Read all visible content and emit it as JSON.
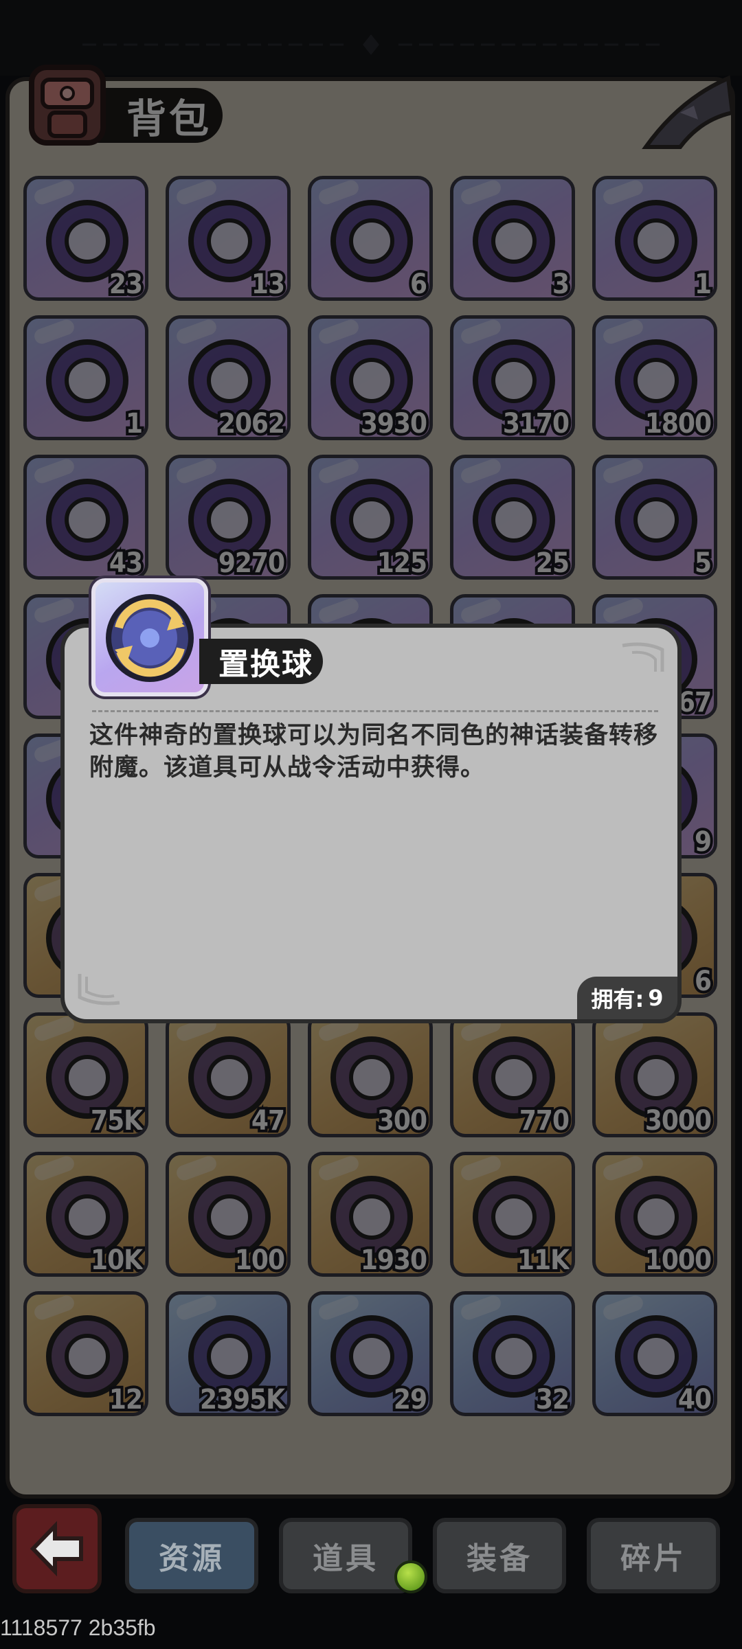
{
  "header": {
    "title": "背包"
  },
  "items": [
    {
      "count": "23",
      "icon": "sword-orb-icon",
      "style": "purple"
    },
    {
      "count": "13",
      "icon": "armor-orb-icon",
      "style": "purple"
    },
    {
      "count": "6",
      "icon": "helmet-orb-icon",
      "style": "purple"
    },
    {
      "count": "3",
      "icon": "ring-orb-icon",
      "style": "purple"
    },
    {
      "count": "1",
      "icon": "emblem-icon",
      "style": "purple"
    },
    {
      "count": "1",
      "icon": "ink-bag-icon",
      "style": "purple"
    },
    {
      "count": "2062",
      "icon": "ruby-gem-icon",
      "style": "purple"
    },
    {
      "count": "3930",
      "icon": "star-badge-icon",
      "style": "purple"
    },
    {
      "count": "3170",
      "icon": "slime-icon",
      "style": "purple"
    },
    {
      "count": "1800",
      "icon": "crown-icon",
      "style": "purple"
    },
    {
      "count": "43",
      "icon": "lotus-icon",
      "style": "purple"
    },
    {
      "count": "9270",
      "icon": "purple-crown-icon",
      "style": "purple"
    },
    {
      "count": "125",
      "icon": "dark-amulet-icon",
      "style": "purple"
    },
    {
      "count": "25",
      "icon": "quill-icon",
      "style": "purple"
    },
    {
      "count": "5",
      "icon": "helmet-book-icon",
      "style": "purple"
    },
    {
      "count": "",
      "icon": "item-icon",
      "style": "purple"
    },
    {
      "count": "",
      "icon": "item-icon",
      "style": "purple"
    },
    {
      "count": "",
      "icon": "item-icon",
      "style": "purple"
    },
    {
      "count": "",
      "icon": "item-icon",
      "style": "purple"
    },
    {
      "count": "67",
      "icon": "item-icon",
      "style": "purple"
    },
    {
      "count": "",
      "icon": "item-icon",
      "style": "purple"
    },
    {
      "count": "",
      "icon": "item-icon",
      "style": "purple"
    },
    {
      "count": "",
      "icon": "item-icon",
      "style": "purple"
    },
    {
      "count": "",
      "icon": "item-icon",
      "style": "purple"
    },
    {
      "count": "9",
      "icon": "item-icon",
      "style": "purple"
    },
    {
      "count": "",
      "icon": "item-icon",
      "style": "gold"
    },
    {
      "count": "",
      "icon": "item-icon",
      "style": "gold"
    },
    {
      "count": "",
      "icon": "item-icon",
      "style": "gold"
    },
    {
      "count": "",
      "icon": "item-icon",
      "style": "gold"
    },
    {
      "count": "6",
      "icon": "item-icon",
      "style": "gold"
    },
    {
      "count": "75K",
      "icon": "crystal-ball-icon",
      "style": "gold"
    },
    {
      "count": "47",
      "icon": "card-icon",
      "style": "gold"
    },
    {
      "count": "300",
      "icon": "banner-icon",
      "style": "gold"
    },
    {
      "count": "770",
      "icon": "shirt-icon",
      "style": "gold"
    },
    {
      "count": "3000",
      "icon": "green-slime-icon",
      "style": "gold"
    },
    {
      "count": "10K",
      "icon": "blue-amulet-icon",
      "style": "gold"
    },
    {
      "count": "100",
      "icon": "feather-orb-icon",
      "style": "gold"
    },
    {
      "count": "1930",
      "icon": "goblet-icon",
      "style": "gold"
    },
    {
      "count": "11K",
      "icon": "heart-icon",
      "style": "gold"
    },
    {
      "count": "1000",
      "icon": "green-rune-icon",
      "style": "gold"
    },
    {
      "count": "12",
      "icon": "dice-icon",
      "style": "gold"
    },
    {
      "count": "2395K",
      "icon": "ice-crystal-icon",
      "style": "blue"
    },
    {
      "count": "29",
      "icon": "sword-orb-icon",
      "style": "blue"
    },
    {
      "count": "32",
      "icon": "armor-orb-icon",
      "style": "blue"
    },
    {
      "count": "40",
      "icon": "helmet-orb-icon",
      "style": "blue"
    }
  ],
  "dialog": {
    "item_name": "置换球",
    "description": "这件神奇的置换球可以为同名不同色的神话装备转移附魔。该道具可从战令活动中获得。",
    "owned_label": "拥有:",
    "owned_count": "9"
  },
  "bottom_tabs": [
    "资源",
    "道具",
    "装备",
    "碎片"
  ],
  "footer_debug": "1118577 2b35fb"
}
